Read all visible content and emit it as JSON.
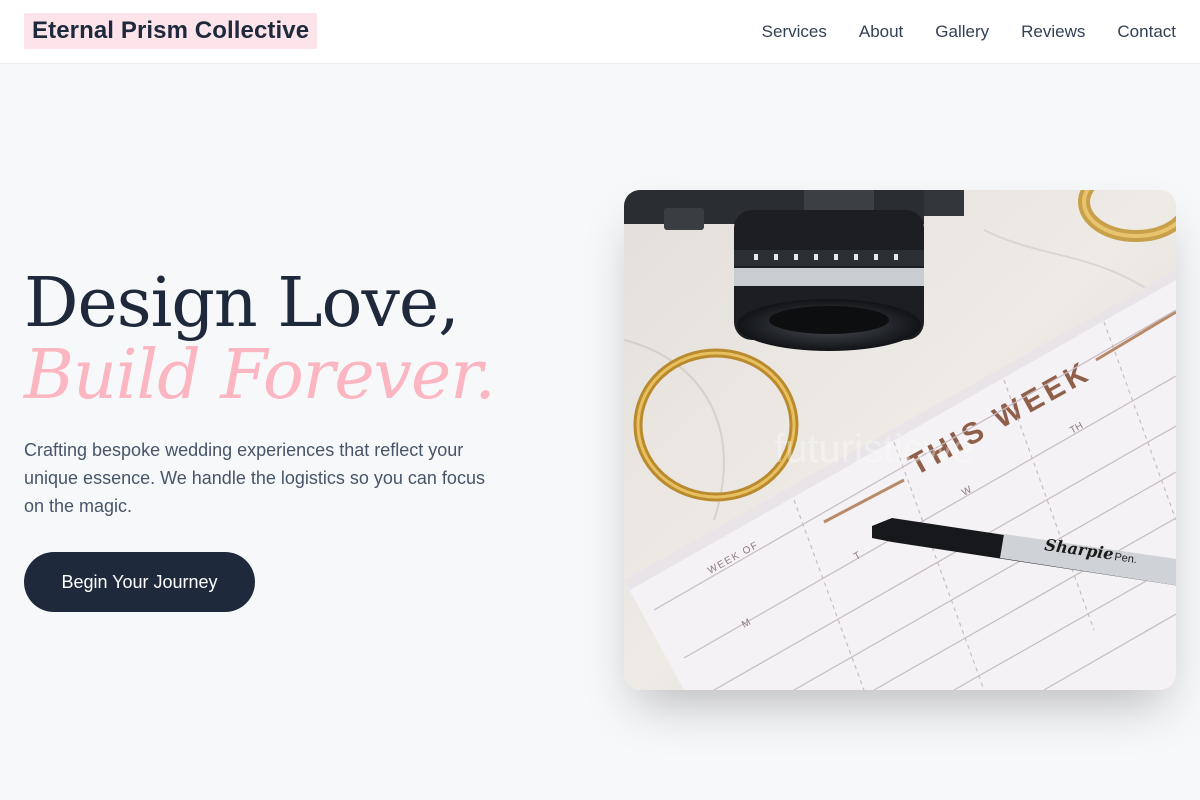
{
  "brand": {
    "name": "Eternal Prism Collective"
  },
  "nav": {
    "items": [
      {
        "label": "Services"
      },
      {
        "label": "About"
      },
      {
        "label": "Gallery"
      },
      {
        "label": "Reviews"
      },
      {
        "label": "Contact"
      }
    ]
  },
  "hero": {
    "title_line1": "Design Love,",
    "title_line2": "Build Forever.",
    "description": "Crafting bespoke wedding experiences that reflect your unique essence. We handle the logistics so you can focus on the magic.",
    "cta_label": "Begin Your Journey"
  },
  "image": {
    "planner_heading": "THIS WEEK",
    "planner_week_of": "WEEK OF",
    "day_labels": [
      "M",
      "T",
      "W",
      "TH"
    ],
    "pen_brand": "Sharpie",
    "pen_type": "Pen.",
    "watermark": "futuristicwe"
  },
  "colors": {
    "brand_highlight": "#fde4ea",
    "accent_pink": "#fbb6c2",
    "dark_navy": "#1e293b",
    "page_background": "#f7f8fa"
  }
}
